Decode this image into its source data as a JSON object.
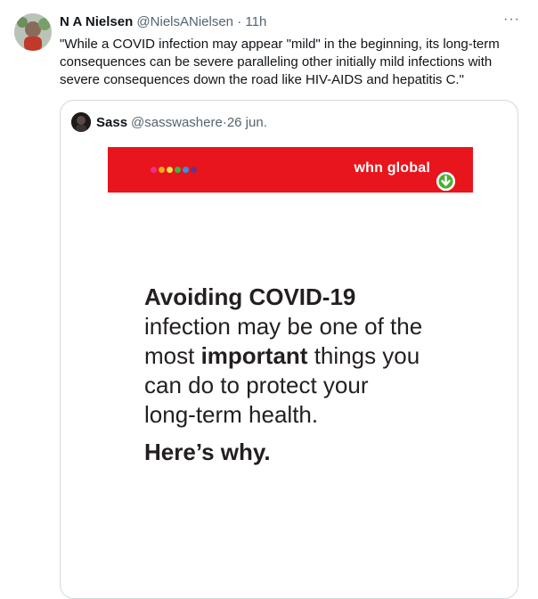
{
  "tweet": {
    "author_name": "N A Nielsen",
    "handle": "@NielsANielsen",
    "separator": " · ",
    "time": "11h",
    "more_label": "···",
    "text": "\"While a COVID infection may appear \"mild\" in the beginning, its long-term consequences can be severe paralleling other initially mild infections with severe consequences down the road like HIV-AIDS and hepatitis C.\""
  },
  "quote": {
    "author_name": "Sass",
    "handle": "@sasswashere",
    "separator": " · ",
    "date": "26 jun.",
    "image": {
      "brand": "whn global",
      "headline_bold": "Avoiding COVID-19",
      "headline_line2": "infection may be one of the",
      "headline_line3_pre": "most ",
      "headline_line3_bold": "important",
      "headline_line3_post": " things you",
      "headline_line4": "can do to protect your",
      "headline_line5": "long-term health.",
      "why": "Here’s why.",
      "banner_color": "#e8151c",
      "dot_colors": [
        "#ec2f8a",
        "#f5a623",
        "#f4e04d",
        "#3db54a",
        "#3a8ee6",
        "#6b2f8f"
      ]
    }
  }
}
